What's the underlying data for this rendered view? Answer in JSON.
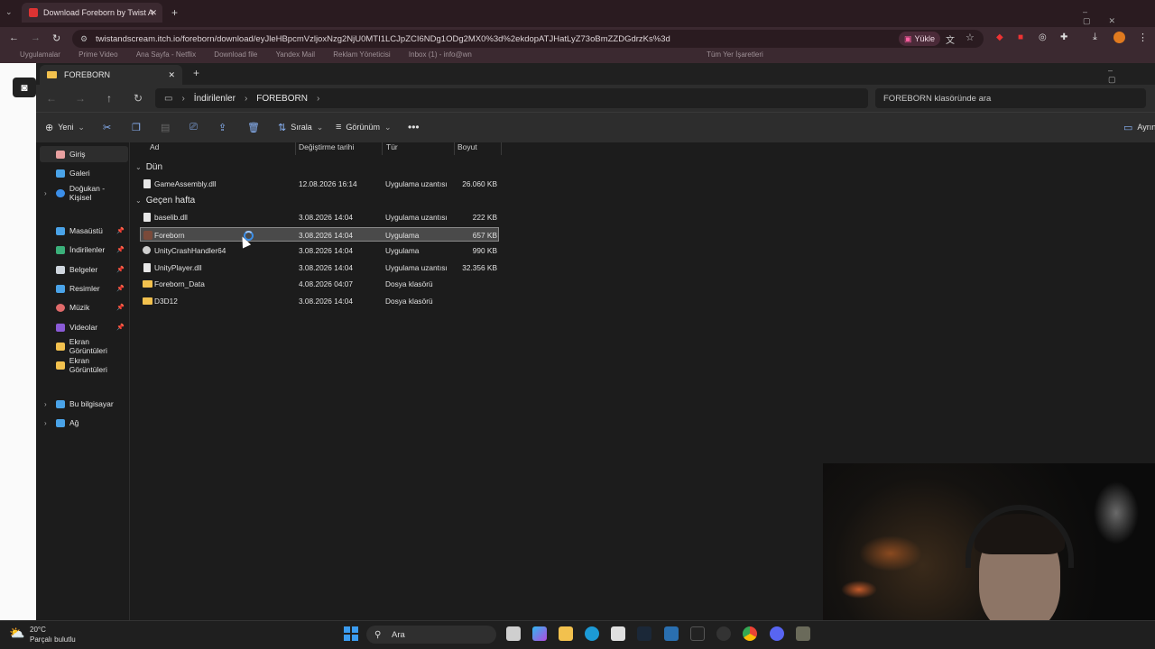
{
  "browser": {
    "tab_title": "Download Foreborn by Twist A",
    "url": "twistandscream.itch.io/foreborn/download/eyJleHBpcmVzljoxNzg2NjU0MTI1LCJpZCI6NDg1ODg2MX0%3d%2ekdopATJHatLyZ73oBmZZDGdrzKs%3d",
    "upload_label": "Yükle",
    "bookmarks": [
      "Uygulamalar",
      "Prime Video",
      "Ana Sayfa - Netflix",
      "Download file",
      "Yandex Mail",
      "Reklam Yöneticisi",
      "Inbox (1) - info@wn",
      "Tüm Yer İşaretleri"
    ]
  },
  "explorer": {
    "tab_title": "FOREBORN",
    "breadcrumb": [
      "İndirilenler",
      "FOREBORN"
    ],
    "search_placeholder": "FOREBORN klasöründe ara",
    "commands": {
      "new": "Yeni",
      "sort": "Sırala",
      "view": "Görünüm",
      "details": "Ayrın"
    },
    "sidebar": [
      {
        "label": "Giriş",
        "color": "#e8a0a0"
      },
      {
        "label": "Galeri",
        "color": "#4aa3e8"
      },
      {
        "label": "Doğukan - Kişisel",
        "color": "#3b8ee8"
      },
      {
        "label": "Masaüstü",
        "color": "#4aa3e8"
      },
      {
        "label": "İndirilenler",
        "color": "#3bb07a"
      },
      {
        "label": "Belgeler",
        "color": "#cfd6de"
      },
      {
        "label": "Resimler",
        "color": "#4aa3e8"
      },
      {
        "label": "Müzik",
        "color": "#e06a6a"
      },
      {
        "label": "Videolar",
        "color": "#8a5ad6"
      },
      {
        "label": "Ekran Görüntüleri",
        "color": "#f2c14e"
      },
      {
        "label": "Ekran Görüntüleri",
        "color": "#f2c14e"
      },
      {
        "label": "Bu bilgisayar",
        "color": "#4aa3e8"
      },
      {
        "label": "Ağ",
        "color": "#4aa3e8"
      }
    ],
    "columns": {
      "name": "Ad",
      "modified": "Değiştirme tarihi",
      "type": "Tür",
      "size": "Boyut"
    },
    "groups": {
      "yesterday": "Dün",
      "last_week": "Geçen hafta"
    },
    "files_yesterday": [
      {
        "name": "GameAssembly.dll",
        "modified": "12.08.2026 16:14",
        "type": "Uygulama uzantısı",
        "size": "26.060 KB"
      }
    ],
    "files_last_week": [
      {
        "name": "baselib.dll",
        "modified": "3.08.2026 14:04",
        "type": "Uygulama uzantısı",
        "size": "222 KB"
      },
      {
        "name": "Foreborn",
        "modified": "3.08.2026 14:04",
        "type": "Uygulama",
        "size": "657 KB"
      },
      {
        "name": "UnityCrashHandler64",
        "modified": "3.08.2026 14:04",
        "type": "Uygulama",
        "size": "990 KB"
      },
      {
        "name": "UnityPlayer.dll",
        "modified": "3.08.2026 14:04",
        "type": "Uygulama uzantısı",
        "size": "32.356 KB"
      },
      {
        "name": "Foreborn_Data",
        "modified": "4.08.2026 04:07",
        "type": "Dosya klasörü",
        "size": ""
      },
      {
        "name": "D3D12",
        "modified": "3.08.2026 14:04",
        "type": "Dosya klasörü",
        "size": ""
      }
    ]
  },
  "taskbar": {
    "temperature": "20°C",
    "weather": "Parçalı bulutlu",
    "search_label": "Ara"
  }
}
